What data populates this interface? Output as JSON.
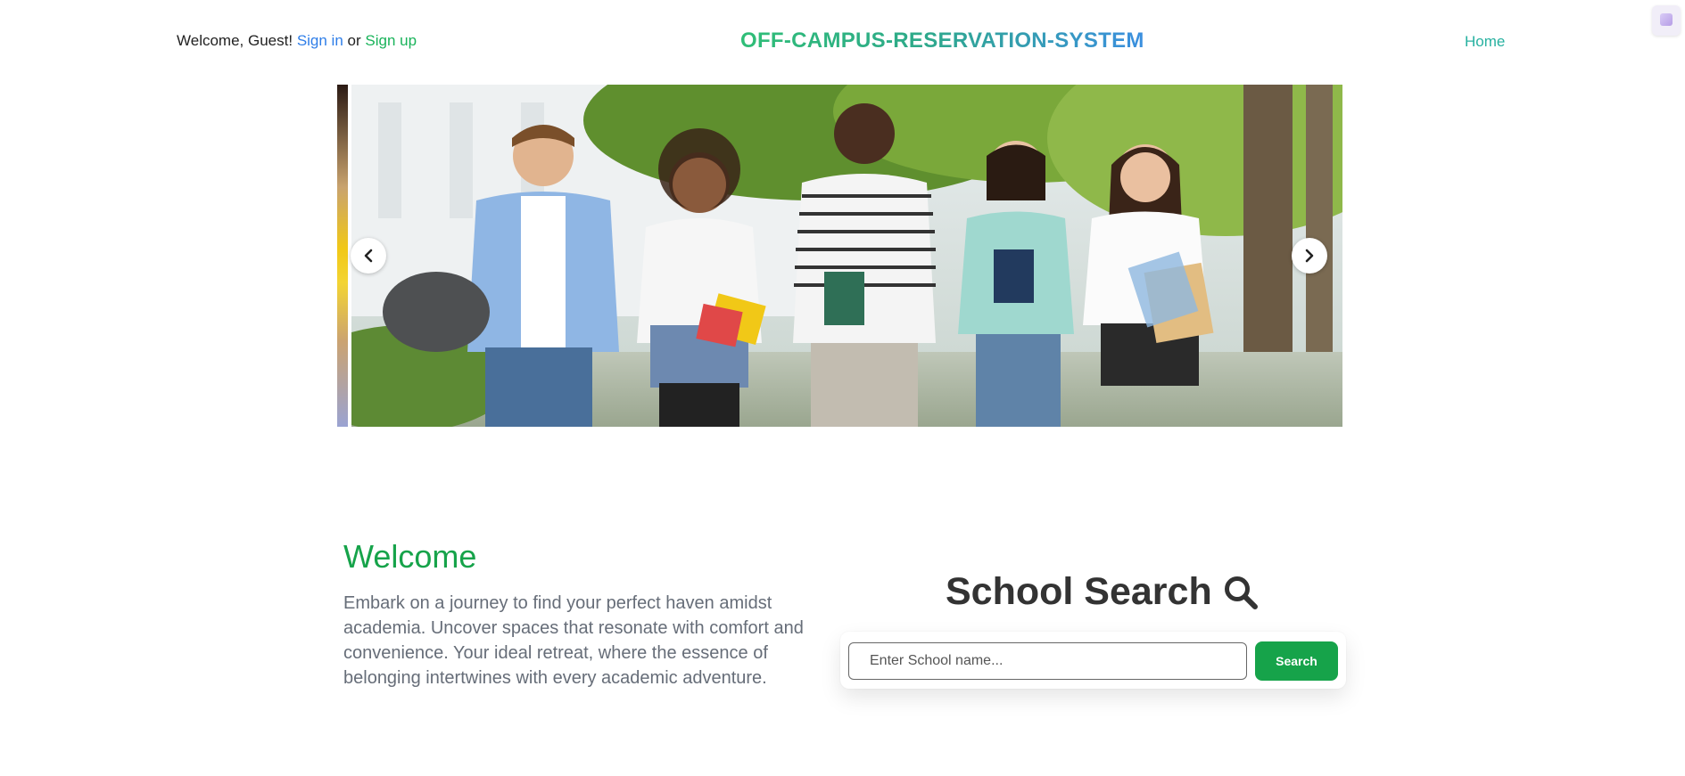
{
  "header": {
    "greeting": "Welcome, Guest!",
    "sign_in": "Sign in",
    "or": "or",
    "sign_up": "Sign up",
    "brand": "OFF-CAMPUS-RESERVATION-SYSTEM",
    "nav_home": "Home"
  },
  "carousel": {
    "prev_icon": "chevron-left-icon",
    "next_icon": "chevron-right-icon",
    "image_alt": "Group of smiling students walking outdoors on campus"
  },
  "welcome": {
    "title": "Welcome",
    "text": "Embark on a journey to find your perfect haven amidst academia. Uncover spaces that resonate with comfort and convenience. Your ideal retreat, where the essence of belonging intertwines with every academic adventure."
  },
  "search": {
    "title": "School Search",
    "icon": "search-icon",
    "placeholder": "Enter School name...",
    "value": "",
    "button_label": "Search"
  },
  "colors": {
    "accent_green": "#16a34a",
    "link_blue": "#2f7ee8",
    "signup_green": "#19b35a",
    "home_teal": "#27b1a0"
  }
}
